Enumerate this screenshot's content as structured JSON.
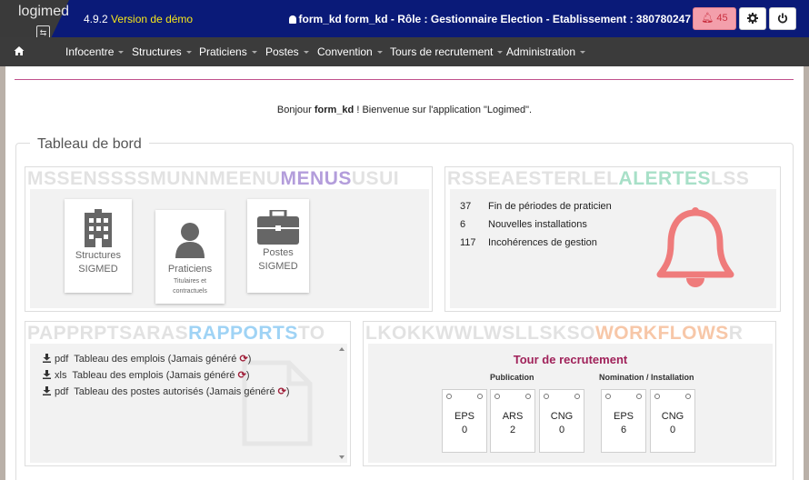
{
  "header": {
    "logo_text": "logimed",
    "version": "4.9.2",
    "version_note": "Version de démo",
    "user_info": "form_kd form_kd - Rôle : Gestionnaire Election - Etablissement : 380780247",
    "alert_count": "45"
  },
  "nav": {
    "items": [
      {
        "label": "Infocentre"
      },
      {
        "label": "Structures"
      },
      {
        "label": "Praticiens"
      },
      {
        "label": "Postes"
      },
      {
        "label": "Convention"
      },
      {
        "label": "Tours de recrutement"
      },
      {
        "label": "Administration"
      }
    ]
  },
  "welcome": {
    "prefix": "Bonjour",
    "user": "form_kd",
    "suffix": "! Bienvenue sur l'application \"Logimed\"."
  },
  "dashboard": {
    "title": "Tableau de bord",
    "menus": {
      "bg_letters": "MSSENSSSSMUNNMEENU",
      "title": "MENUS",
      "bg_letters_after": "USUI",
      "tiles": [
        {
          "line1": "Structures",
          "line2": "SIGMED",
          "line3": ""
        },
        {
          "line1": "Praticiens",
          "line2": "Titulaires et",
          "line3": "contractuels"
        },
        {
          "line1": "Postes",
          "line2": "SIGMED",
          "line3": ""
        }
      ]
    },
    "alertes": {
      "bg_letters": "RSSEAESTERLEL",
      "title": "ALERTES",
      "bg_letters_after": "LSS",
      "rows": [
        {
          "count": "37",
          "label": "Fin de périodes de praticien"
        },
        {
          "count": "6",
          "label": "Nouvelles installations"
        },
        {
          "count": "117",
          "label": "Incohérences de gestion"
        }
      ]
    },
    "rapports": {
      "bg_letters": "PAPPRPTSARAS",
      "title": "RAPPORTS",
      "bg_letters_after": "TO",
      "rows": [
        {
          "format": "pdf",
          "label": "Tableau des emplois",
          "status": "(Jamais généré",
          "close": ")"
        },
        {
          "format": "xls",
          "label": "Tableau des emplois",
          "status": "(Jamais généré",
          "close": ")"
        },
        {
          "format": "pdf",
          "label": "Tableau des postes autorisés",
          "status": "(Jamais généré",
          "close": ")"
        }
      ]
    },
    "workflows": {
      "bg_letters": "LKOKKWWLWSLLSKSO",
      "title": "WORKFLOWS",
      "bg_letters_after": "R",
      "heading": "Tour de recrutement",
      "publication_label": "Publication",
      "nomination_label": "Nomination / Installation",
      "publication": [
        {
          "label": "EPS",
          "value": "0"
        },
        {
          "label": "ARS",
          "value": "2"
        },
        {
          "label": "CNG",
          "value": "0"
        }
      ],
      "nomination": [
        {
          "label": "EPS",
          "value": "6"
        },
        {
          "label": "CNG",
          "value": "0"
        }
      ]
    }
  },
  "colors": {
    "header_bg": "#0a1a78",
    "nav_bg": "#3b3b3b",
    "menus": "#b39ddb",
    "alertes": "#a8e0c8",
    "rapports": "#9fd3f5",
    "workflows": "#f7c7a8",
    "bell": "#ef7b7b",
    "accent": "#c0518c"
  }
}
